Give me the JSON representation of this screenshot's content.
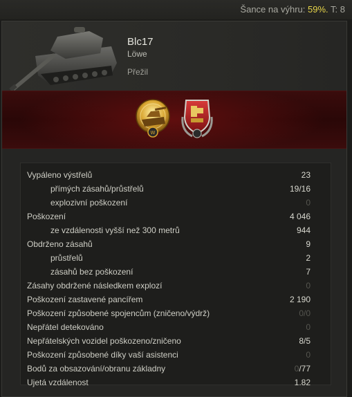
{
  "topbar": {
    "win_label": "Šance na výhru:",
    "win_pct": "59%.",
    "tier_text": "T: 8"
  },
  "tank": {
    "name": "Blc17",
    "player": "Löwe",
    "status": "Přežil",
    "image_icon": "heavy-tank-icon"
  },
  "medals": [
    {
      "name": "gold-tank-medal-icon"
    },
    {
      "name": "red-shield-medal-icon"
    }
  ],
  "stats": [
    {
      "label": "Vypáleno výstřelů",
      "value": "23",
      "sub": false,
      "dim": false
    },
    {
      "label": "přímých zásahů/průstřelů",
      "value": "19/16",
      "sub": true,
      "dim": false
    },
    {
      "label": "explozivní poškození",
      "value": "0",
      "sub": true,
      "dim": true
    },
    {
      "label": "Poškození",
      "value": "4 046",
      "sub": false,
      "dim": false
    },
    {
      "label": "ze vzdálenosti vyšší než 300 metrů",
      "value": "944",
      "sub": true,
      "dim": false
    },
    {
      "label": "Obdrženo zásahů",
      "value": "9",
      "sub": false,
      "dim": false
    },
    {
      "label": "průstřelů",
      "value": "2",
      "sub": true,
      "dim": false
    },
    {
      "label": "zásahů bez poškození",
      "value": "7",
      "sub": true,
      "dim": false
    },
    {
      "label": "Zásahy obdržené následkem explozí",
      "value": "0",
      "sub": false,
      "dim": true
    },
    {
      "label": "Poškození zastavené pancířem",
      "value": "2 190",
      "sub": false,
      "dim": false
    },
    {
      "label": "Poškození způsobené spojencům (zničeno/výdrž)",
      "value": "0/0",
      "sub": false,
      "dim": true
    },
    {
      "label": "Nepřátel detekováno",
      "value": "0",
      "sub": false,
      "dim": true
    },
    {
      "label": "Nepřátelských vozidel poškozeno/zničeno",
      "value": "8/5",
      "sub": false,
      "dim": false
    },
    {
      "label": "Poškození způsobené díky vaší asistenci",
      "value": "0",
      "sub": false,
      "dim": true
    },
    {
      "label": "Bodů za obsazování/obranu základny",
      "value_dim": "0",
      "value_rest": "/77",
      "sub": false,
      "mixed": true
    },
    {
      "label": "Ujetá vzdálenost",
      "value": "1.82",
      "sub": false,
      "dim": false
    }
  ]
}
